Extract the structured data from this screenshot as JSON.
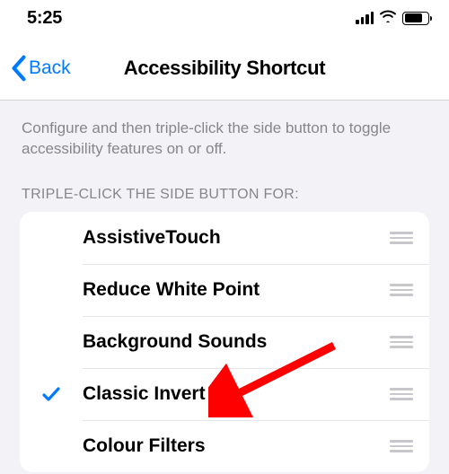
{
  "status": {
    "time": "5:25"
  },
  "nav": {
    "back_label": "Back",
    "title": "Accessibility Shortcut"
  },
  "description": "Configure and then triple-click the side button to toggle accessibility features on or off.",
  "section_header": "TRIPLE-CLICK THE SIDE BUTTON FOR:",
  "items": [
    {
      "label": "AssistiveTouch",
      "checked": false
    },
    {
      "label": "Reduce White Point",
      "checked": false
    },
    {
      "label": "Background Sounds",
      "checked": false
    },
    {
      "label": "Classic Invert",
      "checked": true
    },
    {
      "label": "Colour Filters",
      "checked": false
    }
  ],
  "colors": {
    "accent": "#007aff",
    "secondary_text": "#86868b",
    "background": "#f2f2f7",
    "separator": "#e5e5ea"
  }
}
